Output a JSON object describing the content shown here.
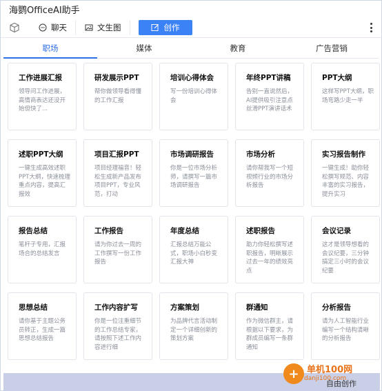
{
  "window": {
    "title": "海鹦OfficeAI助手"
  },
  "toolbar": {
    "chat_label": "聊天",
    "image_label": "文生图",
    "create_label": "创作"
  },
  "tabs": [
    "职场",
    "媒体",
    "教育",
    "广告营销"
  ],
  "cards": [
    {
      "title": "工作进展汇报",
      "desc": "领导问工作进展，高情商表达还没开始但快了..."
    },
    {
      "title": "研发展示PPT",
      "desc": "帮你做领导看得懂的工作汇报"
    },
    {
      "title": "培训心得体会",
      "desc": "写一份培训心得体会"
    },
    {
      "title": "年终PPT讲稿",
      "desc": "告别一直说然后，AI提供吸引注意点丝滑PPT演讲话术"
    },
    {
      "title": "PPT大纲",
      "desc": "这样写PPT大纲，职场弯路少走一半"
    },
    {
      "title": "述职PPT大纲",
      "desc": "一键生成高效述职PPT大纲，快速梳理重点内容，提高汇报效"
    },
    {
      "title": "项目汇报PPT",
      "desc": "项目经理福音！轻松生成新产品发布项目PPT，专业风范，打动"
    },
    {
      "title": "市场调研报告",
      "desc": "你是一位市场分析师，请撰写一篇市场调研报告"
    },
    {
      "title": "市场分析",
      "desc": "请你帮我写一个短视频行业的市场分析报告"
    },
    {
      "title": "实习报告制作",
      "desc": "一键生成！助你轻松撰写规范、内容丰富的实习报告，提升实习"
    },
    {
      "title": "报告总结",
      "desc": "笔杆子专用，汇报场合的总结发言"
    },
    {
      "title": "工作报告",
      "desc": "请为你过去一周的工作撰写一份工作报告"
    },
    {
      "title": "年度总结",
      "desc": "汇报总结万能公式，职场小白秒变汇报大神"
    },
    {
      "title": "述职报告",
      "desc": "助力你轻松撰写述职报告，明晰展示过去一年的绩效亮点"
    },
    {
      "title": "会议记录",
      "desc": "这才是领导想看的会议纪要，三分钟搞定三小时的会议纪要"
    },
    {
      "title": "思想总结",
      "desc": "请你基于主题公务员转正，生成一篇思想总结报告"
    },
    {
      "title": "工作内容扩写",
      "desc": "你是一位注重细节的工作总结专家，请按照下述工作内容进行细"
    },
    {
      "title": "方案策划",
      "desc": "为品牌代言活动制定一个详细创新的策划方案"
    },
    {
      "title": "群通知",
      "desc": "作为微信群主，请根据以下要求，为群成员编写一条群通知"
    },
    {
      "title": "分析报告",
      "desc": "请为人工智能行业编写一个结构清晰的分析报告"
    }
  ],
  "footer": {
    "free_label": "自由创作"
  },
  "watermark": {
    "text": "单机100网",
    "sub": "danji100.com"
  },
  "colors": {
    "accent": "#3b82f6",
    "tab_active": "#2f6fe6",
    "footer_bg": "#c9cfe6"
  }
}
